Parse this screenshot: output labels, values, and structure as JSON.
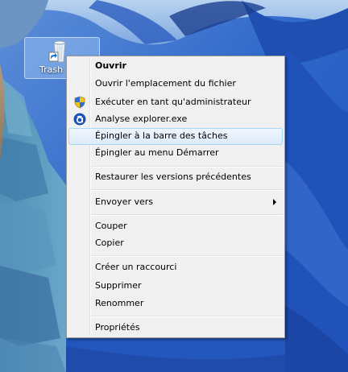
{
  "desktop": {
    "icon_label": "Trash"
  },
  "context_menu": {
    "open": "Ouvrir",
    "open_file_location": "Ouvrir l'emplacement du fichier",
    "run_as_admin": "Exécuter en tant qu'administrateur",
    "analyze": "Analyse explorer.exe",
    "pin_taskbar": "Épingler à la barre des tâches",
    "pin_start": "Épingler au menu Démarrer",
    "restore_versions": "Restaurer les versions précédentes",
    "send_to": "Envoyer vers",
    "cut": "Couper",
    "copy": "Copier",
    "create_shortcut": "Créer un raccourci",
    "delete": "Supprimer",
    "rename": "Renommer",
    "properties": "Propriétés"
  },
  "colors": {
    "menu_background": "#f0f0f0",
    "menu_border": "#979797",
    "hover_border": "#a8d8f7",
    "wallpaper_blue": "#2a62c6",
    "avast_blue": "#1b57c4"
  },
  "icons": {
    "desktop_icon": "recycle-bin-shortcut-icon",
    "run_as_admin": "uac-shield-icon",
    "analyze": "antivirus-a-icon",
    "send_to": "submenu-arrow-icon"
  }
}
